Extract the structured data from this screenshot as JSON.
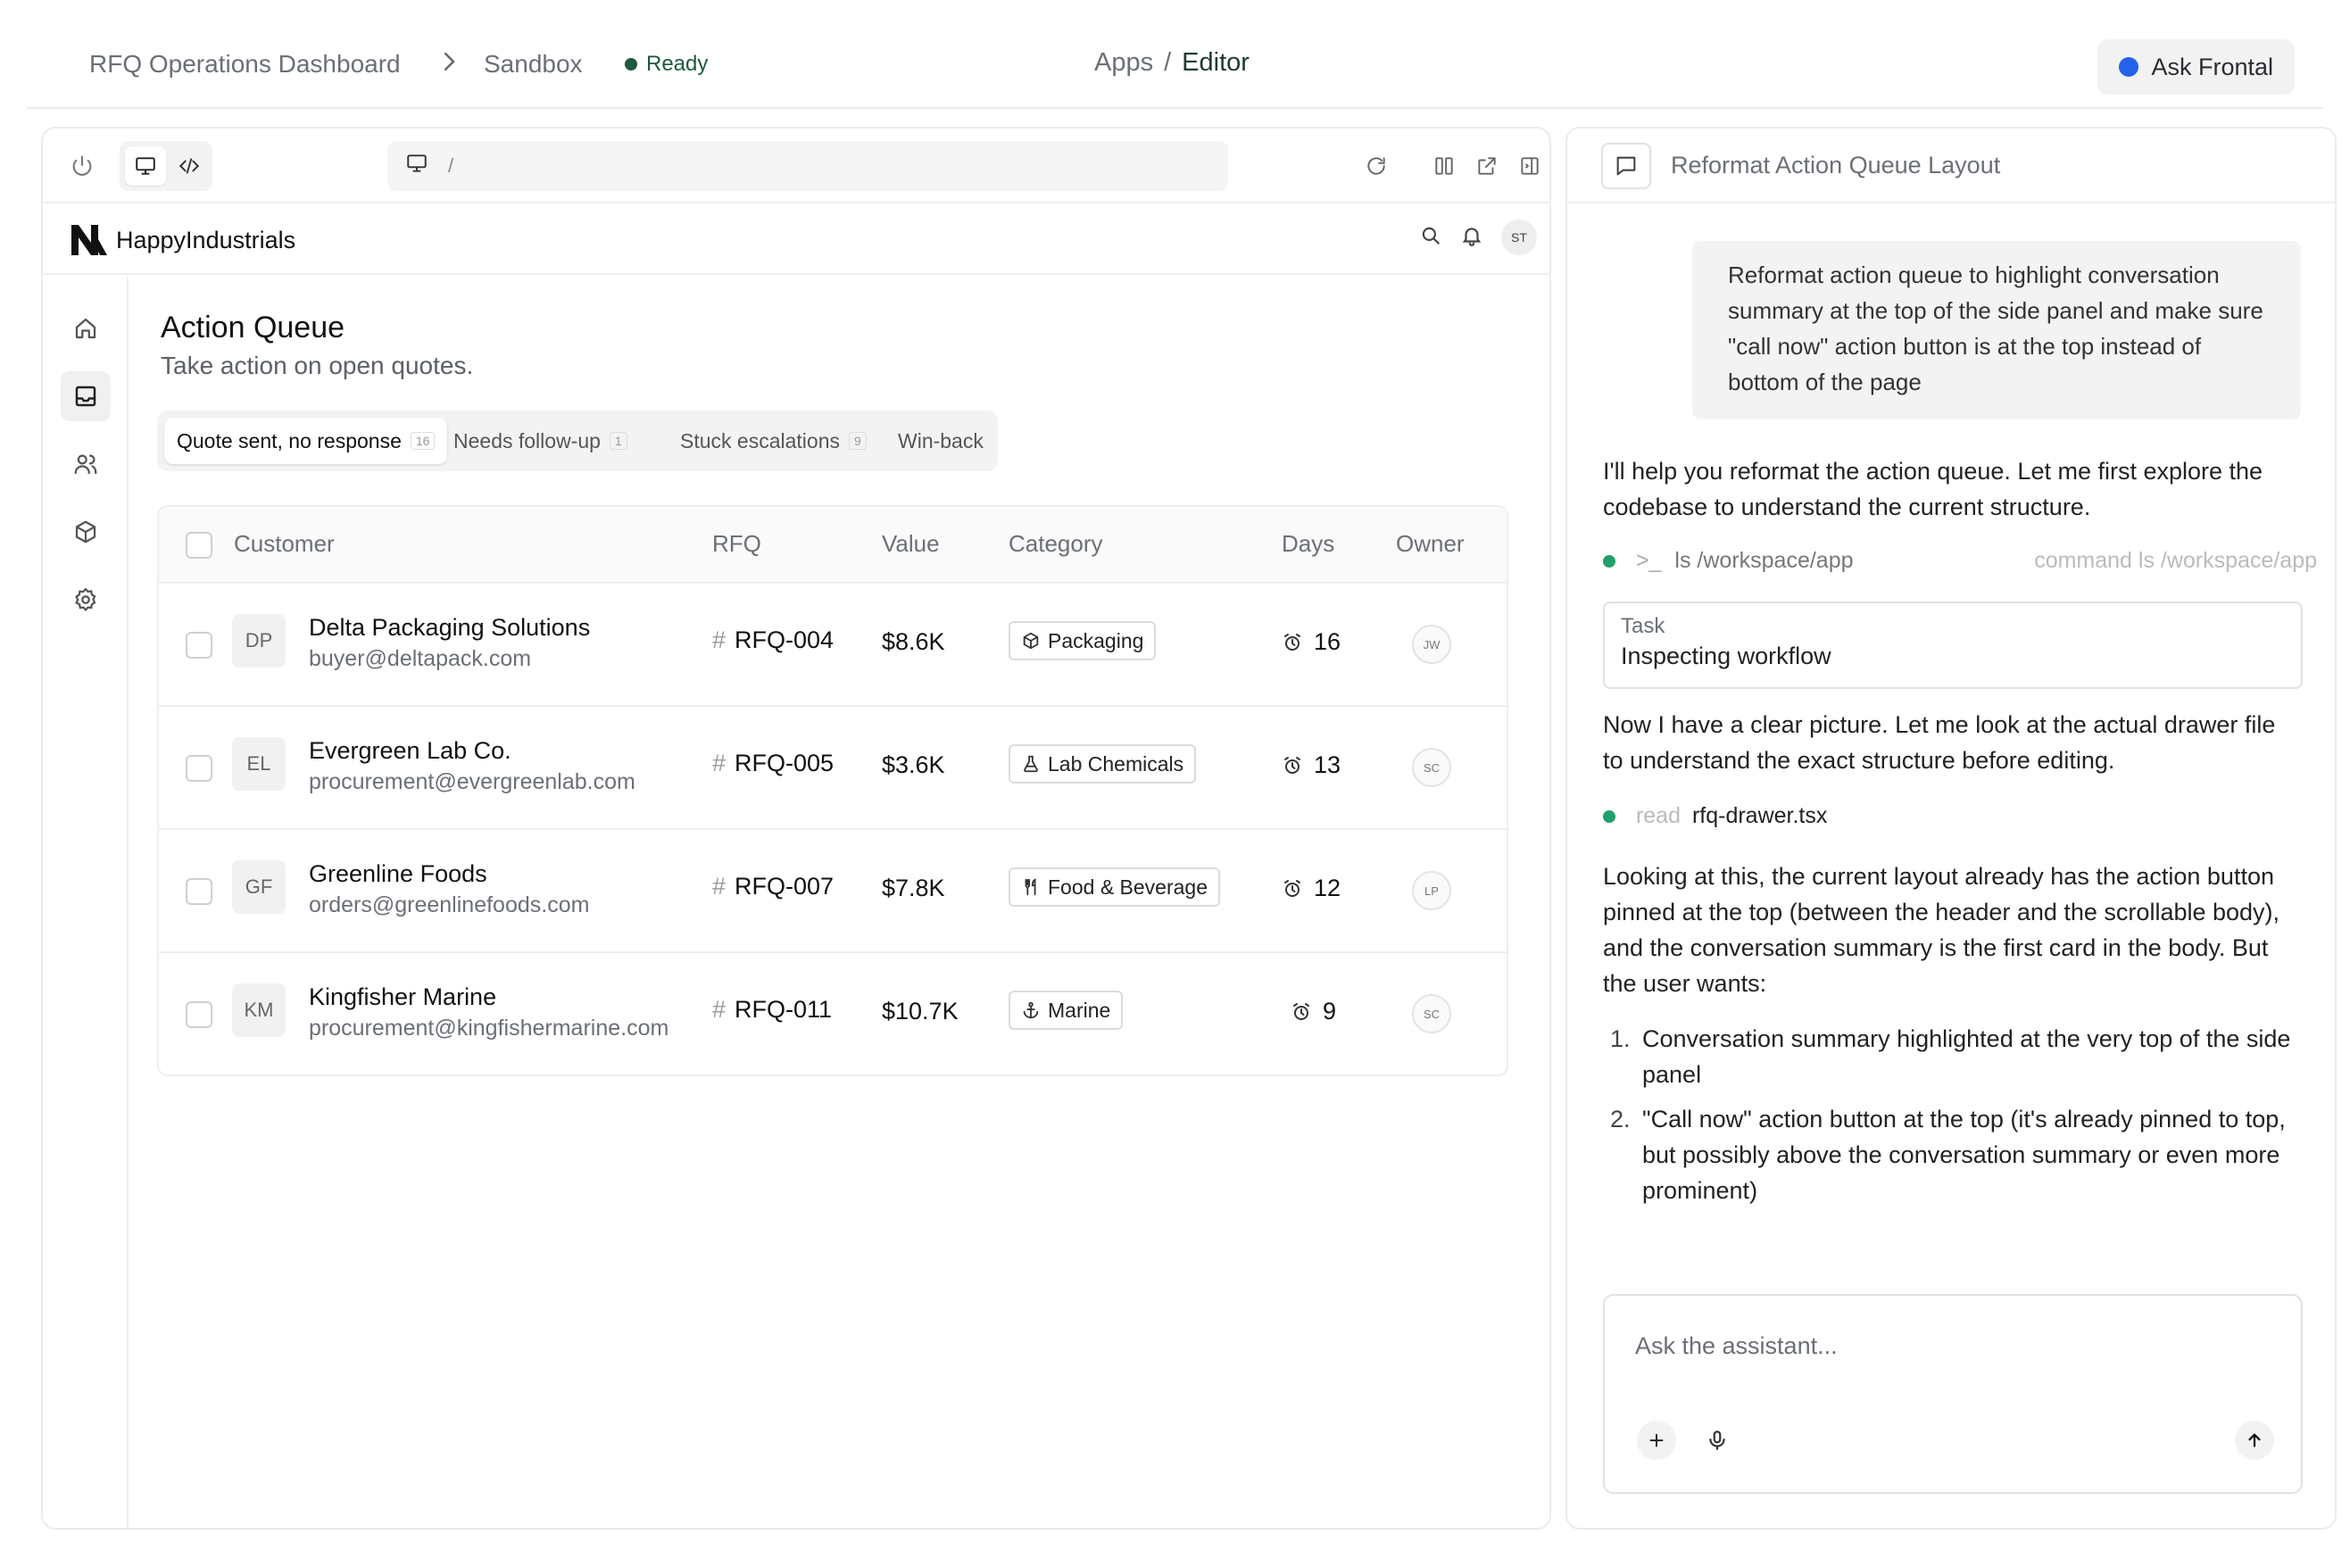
{
  "topbar": {
    "breadcrumb": [
      "RFQ Operations Dashboard",
      "Sandbox"
    ],
    "status": "Ready",
    "center": {
      "apps": "Apps",
      "separator": "/",
      "editor": "Editor"
    },
    "ask_button": "Ask Frontal",
    "colors": {
      "status": "#1d5a3e",
      "ask_dot": "#2563eb"
    }
  },
  "preview": {
    "url": "/",
    "app": {
      "logo_text": "HappyIndustrials",
      "avatar": "ST"
    },
    "nav": [
      "home-icon",
      "inbox-icon",
      "users-icon",
      "package-icon",
      "settings-icon"
    ],
    "page": {
      "title": "Action Queue",
      "subtitle": "Take action on open quotes.",
      "tabs": [
        {
          "label": "Quote sent, no response",
          "count": "16"
        },
        {
          "label": "Needs follow-up",
          "count": "1"
        },
        {
          "label": "Stuck escalations",
          "count": "9"
        },
        {
          "label": "Win-back",
          "count": ""
        }
      ],
      "columns": [
        "Customer",
        "RFQ",
        "Value",
        "Category",
        "Days",
        "Owner"
      ],
      "rows": [
        {
          "initials": "DP",
          "name": "Delta Packaging Solutions",
          "email": "buyer@deltapack.com",
          "rfq": "RFQ-004",
          "value": "$8.6K",
          "category": "Packaging",
          "category_icon": "box-icon",
          "days": "16",
          "owner": "JW"
        },
        {
          "initials": "EL",
          "name": "Evergreen Lab Co.",
          "email": "procurement@evergreenlab.com",
          "rfq": "RFQ-005",
          "value": "$3.6K",
          "category": "Lab Chemicals",
          "category_icon": "flask-icon",
          "days": "13",
          "owner": "SC"
        },
        {
          "initials": "GF",
          "name": "Greenline Foods",
          "email": "orders@greenlinefoods.com",
          "rfq": "RFQ-007",
          "value": "$7.8K",
          "category": "Food & Beverage",
          "category_icon": "utensils-icon",
          "days": "12",
          "owner": "LP"
        },
        {
          "initials": "KM",
          "name": "Kingfisher Marine",
          "email": "procurement@kingfishermarine.com",
          "rfq": "RFQ-011",
          "value": "$10.7K",
          "category": "Marine",
          "category_icon": "anchor-icon",
          "days": "9",
          "owner": "SC"
        }
      ]
    }
  },
  "chat": {
    "title": "Reformat Action Queue Layout",
    "user_message": "Reformat action queue to highlight conversation summary at the top of the side panel and make sure \"call now\" action button is at the top instead of bottom of the page",
    "reply_1": "I'll help you reformat the action queue. Let me first explore the codebase to understand the current structure.",
    "command": {
      "prompt": ">_",
      "text": "ls /workspace/app",
      "hint": "command ls /workspace/app"
    },
    "task": {
      "label": "Task",
      "value": "Inspecting workflow"
    },
    "reply_2": "Now I have a clear picture. Let me look at the actual drawer file to understand the exact structure before editing.",
    "read": {
      "verb": "read",
      "file": "rfq-drawer.tsx"
    },
    "reply_3": "Looking at this, the current layout already has the action button pinned at the top (between the header and the scrollable body), and the conversation summary is the first card in the body. But the user wants:",
    "list": [
      {
        "num": "1.",
        "text": "Conversation summary highlighted at the very top of the side panel"
      },
      {
        "num": "2.",
        "text": "\"Call now\" action button at the top (it's already pinned to top, but possibly above the conversation summary or even more prominent)"
      }
    ],
    "composer": {
      "placeholder": "Ask the assistant..."
    },
    "accent": "#22a06b"
  }
}
